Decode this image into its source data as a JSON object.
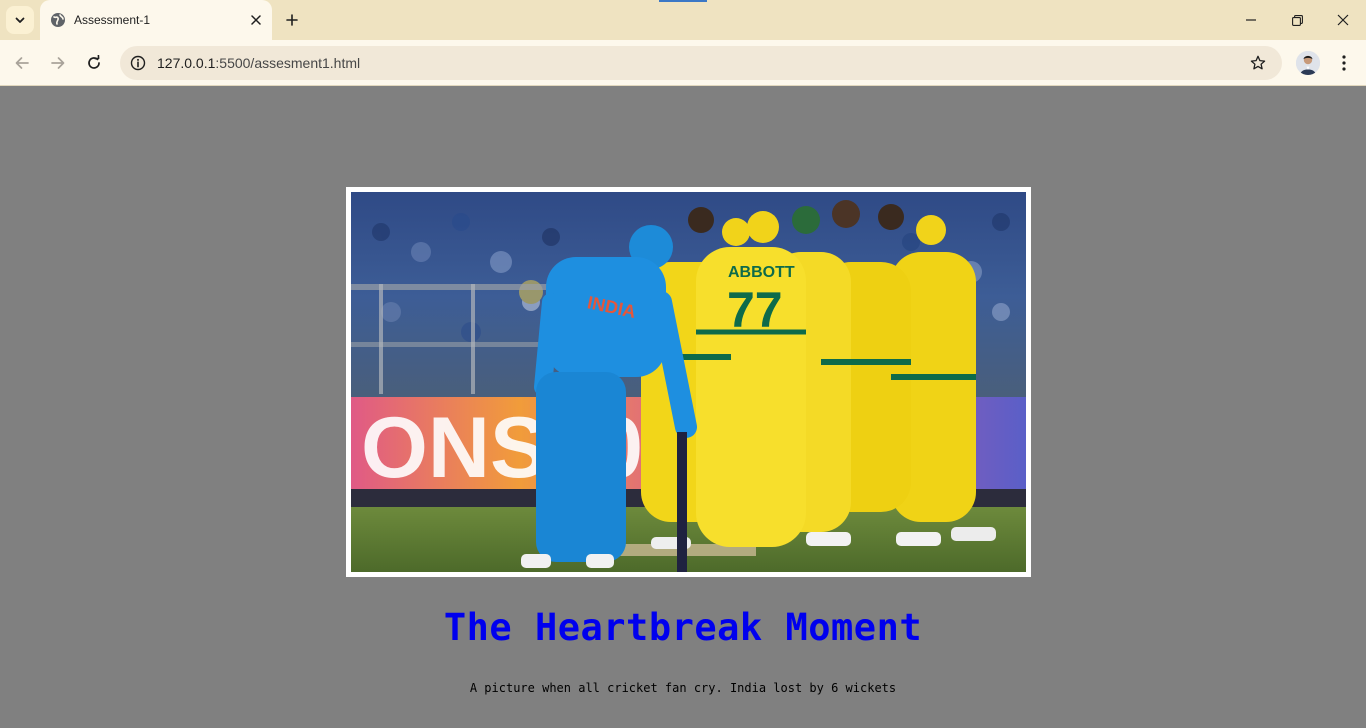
{
  "browser": {
    "tab_title": "Assessment-1",
    "url_host": "127.0.0.1",
    "url_path": ":5500/assesment1.html"
  },
  "page": {
    "heading": "The Heartbreak Moment",
    "caption": "A picture when all cricket fan cry. India lost by 6 wickets",
    "photo": {
      "left_player": {
        "jersey_text": "INDIA"
      },
      "center_player": {
        "name": "ABBOTT",
        "number": "77"
      }
    }
  },
  "colors": {
    "page_background": "#808080",
    "heading_color": "#0000ee",
    "india_jersey": "#1e8fe0",
    "australia_jersey": "#f2d619",
    "australia_trim": "#0e6b4a"
  },
  "icons": [
    "chevron-down-icon",
    "globe-icon",
    "close-icon",
    "plus-icon",
    "minimize-icon",
    "restore-icon",
    "window-close-icon",
    "back-arrow-icon",
    "forward-arrow-icon",
    "reload-icon",
    "info-icon",
    "star-icon",
    "more-vert-icon"
  ]
}
